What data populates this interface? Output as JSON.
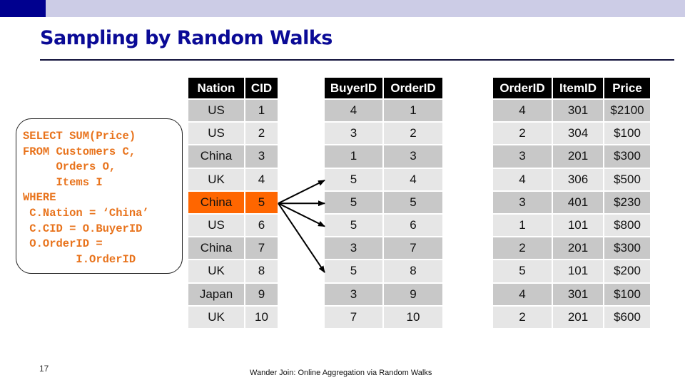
{
  "slide": {
    "title": "Sampling by Random Walks",
    "number": "17",
    "footer": "Wander Join: Online Aggregation via Random Walks",
    "colors": {
      "title": "#0a0a96",
      "sql": "#e8731c",
      "highlight": "#ff6600",
      "header_bg": "#000000"
    }
  },
  "sql": {
    "lines": [
      "SELECT SUM(Price)",
      "FROM Customers C,",
      "     Orders O,",
      "     Items I",
      "WHERE",
      " C.Nation = ‘China’",
      " C.CID = O.BuyerID",
      " O.OrderID =",
      "        I.OrderID"
    ]
  },
  "customers": {
    "headers": [
      "Nation",
      "CID"
    ],
    "rows": [
      [
        "US",
        "1"
      ],
      [
        "US",
        "2"
      ],
      [
        "China",
        "3"
      ],
      [
        "UK",
        "4"
      ],
      [
        "China",
        "5"
      ],
      [
        "US",
        "6"
      ],
      [
        "China",
        "7"
      ],
      [
        "UK",
        "8"
      ],
      [
        "Japan",
        "9"
      ],
      [
        "UK",
        "10"
      ]
    ],
    "highlighted_row": 4
  },
  "orders": {
    "headers": [
      "BuyerID",
      "OrderID"
    ],
    "rows": [
      [
        "4",
        "1"
      ],
      [
        "3",
        "2"
      ],
      [
        "1",
        "3"
      ],
      [
        "5",
        "4"
      ],
      [
        "5",
        "5"
      ],
      [
        "5",
        "6"
      ],
      [
        "3",
        "7"
      ],
      [
        "5",
        "8"
      ],
      [
        "3",
        "9"
      ],
      [
        "7",
        "10"
      ]
    ]
  },
  "items": {
    "headers": [
      "OrderID",
      "ItemID",
      "Price"
    ],
    "rows": [
      [
        "4",
        "301",
        "$2100"
      ],
      [
        "2",
        "304",
        "$100"
      ],
      [
        "3",
        "201",
        "$300"
      ],
      [
        "4",
        "306",
        "$500"
      ],
      [
        "3",
        "401",
        "$230"
      ],
      [
        "1",
        "101",
        "$800"
      ],
      [
        "2",
        "201",
        "$300"
      ],
      [
        "5",
        "101",
        "$200"
      ],
      [
        "4",
        "301",
        "$100"
      ],
      [
        "2",
        "201",
        "$600"
      ]
    ]
  },
  "arrows": {
    "from_customer_row": 4,
    "to_order_rows": [
      3,
      4,
      5,
      7
    ]
  }
}
